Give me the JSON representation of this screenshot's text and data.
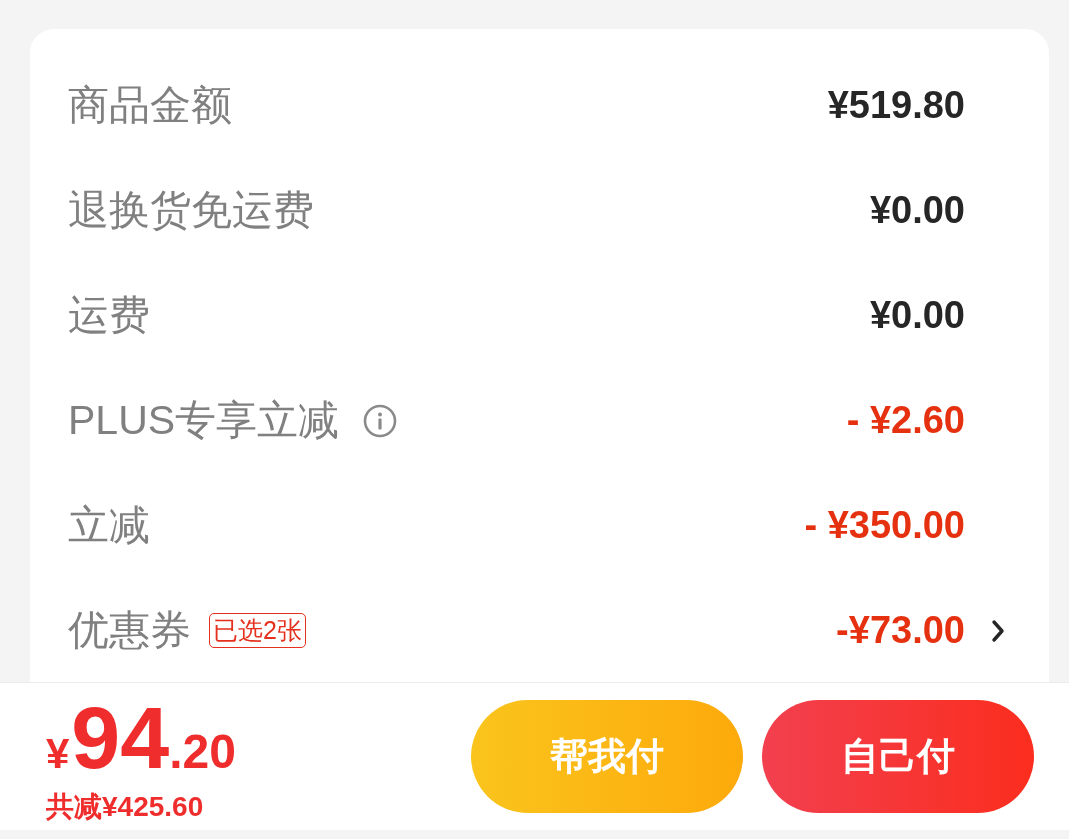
{
  "fee_rows": [
    {
      "kind": "plain",
      "label": "商品金额",
      "value": "¥519.80",
      "discount": false
    },
    {
      "kind": "plain",
      "label": "退换货免运费",
      "value": "¥0.00",
      "discount": false
    },
    {
      "kind": "plain",
      "label": "运费",
      "value": "¥0.00",
      "discount": false
    },
    {
      "kind": "info",
      "label": "PLUS专享立减",
      "value": "- ¥2.60",
      "discount": true
    },
    {
      "kind": "plain",
      "label": "立减",
      "value": "- ¥350.00",
      "discount": true
    },
    {
      "kind": "link",
      "label": "优惠券",
      "tag": "已选2张",
      "value": "-¥73.00",
      "discount": true
    }
  ],
  "total": {
    "currency": "¥",
    "integer": "94",
    "decimal": ".20",
    "saved": "共减¥425.60"
  },
  "buttons": [
    {
      "label": "帮我付",
      "kind": "secondary"
    },
    {
      "label": "自己付",
      "kind": "primary"
    }
  ]
}
